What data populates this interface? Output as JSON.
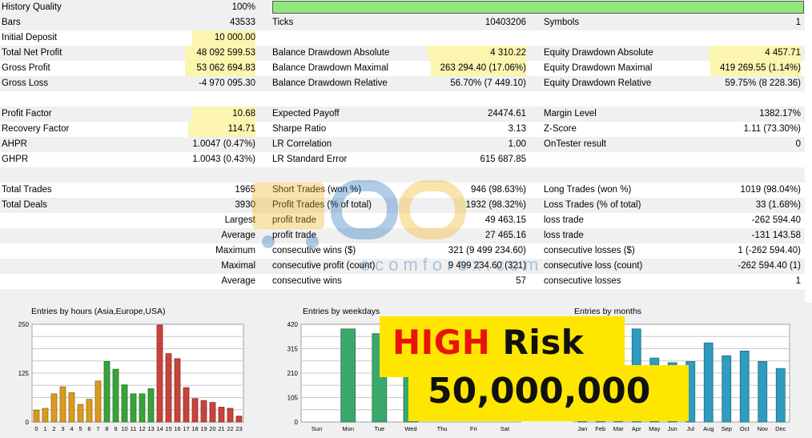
{
  "stats": {
    "history_quality": {
      "label": "History Quality",
      "value": "100%"
    },
    "bars": {
      "label": "Bars",
      "value": "43533"
    },
    "ticks": {
      "label": "Ticks",
      "value": "10403206"
    },
    "symbols": {
      "label": "Symbols",
      "value": "1"
    },
    "initial_deposit": {
      "label": "Initial Deposit",
      "value": "10 000.00"
    },
    "total_net_profit": {
      "label": "Total Net Profit",
      "value": "48 092 599.53"
    },
    "balance_dd_abs": {
      "label": "Balance Drawdown Absolute",
      "value": "4 310.22"
    },
    "equity_dd_abs": {
      "label": "Equity Drawdown Absolute",
      "value": "4 457.71"
    },
    "gross_profit": {
      "label": "Gross Profit",
      "value": "53 062 694.83"
    },
    "balance_dd_max": {
      "label": "Balance Drawdown Maximal",
      "value": "263 294.40 (17.06%)"
    },
    "equity_dd_max": {
      "label": "Equity Drawdown Maximal",
      "value": "419 269.55 (1.14%)"
    },
    "gross_loss": {
      "label": "Gross Loss",
      "value": "-4 970 095.30"
    },
    "balance_dd_rel": {
      "label": "Balance Drawdown Relative",
      "value": "56.70% (7 449.10)"
    },
    "equity_dd_rel": {
      "label": "Equity Drawdown Relative",
      "value": "59.75% (8 228.36)"
    },
    "profit_factor": {
      "label": "Profit Factor",
      "value": "10.68"
    },
    "expected_payoff": {
      "label": "Expected Payoff",
      "value": "24474.61"
    },
    "margin_level": {
      "label": "Margin Level",
      "value": "1382.17%"
    },
    "recovery_factor": {
      "label": "Recovery Factor",
      "value": "114.71"
    },
    "sharpe_ratio": {
      "label": "Sharpe Ratio",
      "value": "3.13"
    },
    "z_score": {
      "label": "Z-Score",
      "value": "1.11 (73.30%)"
    },
    "ahpr": {
      "label": "AHPR",
      "value": "1.0047 (0.47%)"
    },
    "lr_correlation": {
      "label": "LR Correlation",
      "value": "1.00"
    },
    "ontester": {
      "label": "OnTester result",
      "value": "0"
    },
    "ghpr": {
      "label": "GHPR",
      "value": "1.0043 (0.43%)"
    },
    "lr_std_error": {
      "label": "LR Standard Error",
      "value": "615 687.85"
    },
    "total_trades": {
      "label": "Total Trades",
      "value": "1965"
    },
    "short_trades": {
      "label": "Short Trades (won %)",
      "value": "946 (98.63%)"
    },
    "long_trades": {
      "label": "Long Trades (won %)",
      "value": "1019 (98.04%)"
    },
    "total_deals": {
      "label": "Total Deals",
      "value": "3930"
    },
    "profit_trades": {
      "label": "Profit Trades (% of total)",
      "value": "1932 (98.32%)"
    },
    "loss_trades": {
      "label": "Loss Trades (% of total)",
      "value": "33 (1.68%)"
    },
    "largest": {
      "label": "Largest",
      "col2_label": "profit trade",
      "col2_value": "49 463.15",
      "col3_label": "loss trade",
      "col3_value": "-262 594.40"
    },
    "average": {
      "label": "Average",
      "col2_label": "profit trade",
      "col2_value": "27 465.16",
      "col3_label": "loss trade",
      "col3_value": "-131 143.58"
    },
    "maximum": {
      "label": "Maximum",
      "col2_label": "consecutive wins ($)",
      "col2_value": "321 (9 499 234.60)",
      "col3_label": "consecutive losses ($)",
      "col3_value": "1 (-262 594.40)"
    },
    "maximal": {
      "label": "Maximal",
      "col2_label": "consecutive profit (count)",
      "col2_value": "9 499 234.60 (321)",
      "col3_label": "consecutive loss (count)",
      "col3_value": "-262 594.40 (1)"
    },
    "average2": {
      "label": "Average",
      "col2_label": "consecutive wins",
      "col2_value": "57",
      "col3_label": "consecutive losses",
      "col3_value": "1"
    }
  },
  "overlay": {
    "high": "HIGH",
    "risk": "Risk",
    "amount": "50,000,000",
    "colors": {
      "background": "#ffe600",
      "high": "#e8140a",
      "risk": "#111111"
    }
  },
  "watermark": {
    "text": "ecomforex.com"
  },
  "chart_data": [
    {
      "type": "bar",
      "title": "Entries by hours (Asia,Europe,USA)",
      "categories": [
        "0",
        "1",
        "2",
        "3",
        "4",
        "5",
        "6",
        "7",
        "8",
        "9",
        "10",
        "11",
        "12",
        "13",
        "14",
        "15",
        "16",
        "17",
        "18",
        "19",
        "20",
        "21",
        "22",
        "23"
      ],
      "values": [
        30,
        35,
        72,
        90,
        75,
        45,
        58,
        105,
        155,
        135,
        95,
        72,
        72,
        85,
        248,
        175,
        162,
        88,
        60,
        55,
        50,
        38,
        35,
        15
      ],
      "yticks": [
        "0",
        "125",
        "250"
      ],
      "ylim": [
        0,
        250
      ],
      "colors": {
        "asia": "#d99a1e",
        "europe": "#3aa23a",
        "usa": "#c8433c"
      }
    },
    {
      "type": "bar",
      "title": "Entries by weekdays",
      "categories": [
        "Sun",
        "Mon",
        "Tue",
        "Wed",
        "Thu",
        "Fri",
        "Sat"
      ],
      "values": [
        0,
        400,
        380,
        330,
        0,
        0,
        0
      ],
      "yticks": [
        "0",
        "105",
        "210",
        "315",
        "420"
      ],
      "ylim": [
        0,
        420
      ],
      "color": "#3aa86a"
    },
    {
      "type": "bar",
      "title": "Entries by months",
      "categories": [
        "Jan",
        "Feb",
        "Mar",
        "Apr",
        "May",
        "Jun",
        "Jul",
        "Aug",
        "Sep",
        "Oct",
        "Nov",
        "Dec"
      ],
      "values": [
        150,
        200,
        215,
        400,
        275,
        255,
        260,
        340,
        285,
        305,
        260,
        230
      ],
      "ylim": [
        0,
        420
      ],
      "color": "#2e9bbf"
    }
  ]
}
